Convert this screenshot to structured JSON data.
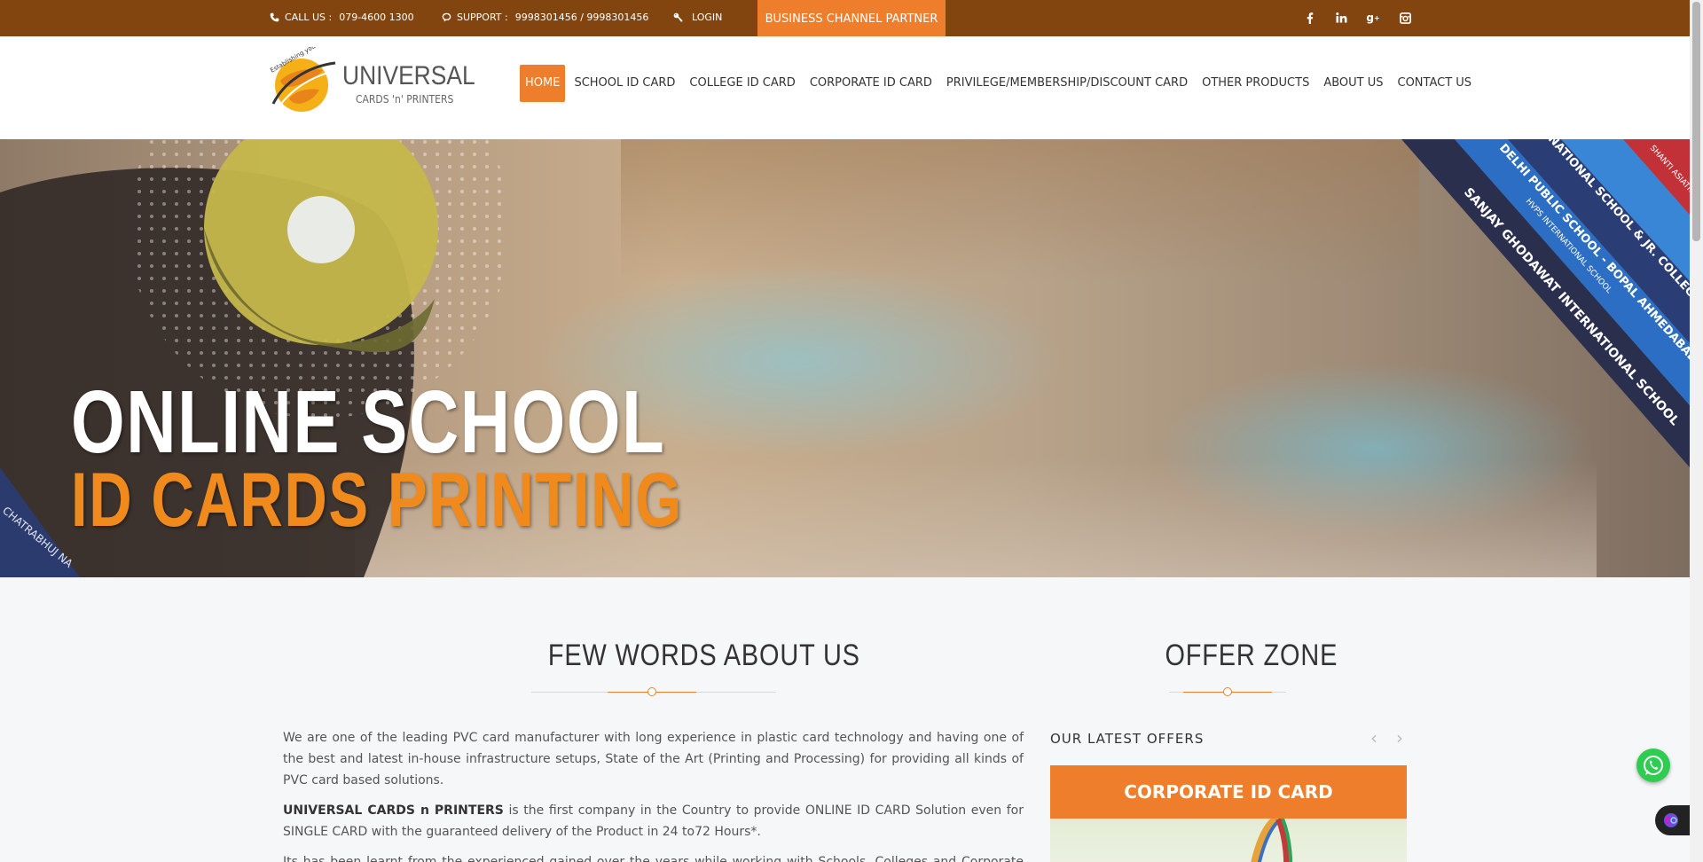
{
  "topbar": {
    "call_label": "CALL US :",
    "call_number": "079-4600 1300",
    "support_label": "SUPPORT :",
    "support_numbers": "9998301456 / 9998301456",
    "login_label": "LOGIN",
    "partner_button": "BUSINESS CHANNEL PARTNER",
    "social": [
      "facebook-icon",
      "linkedin-icon",
      "google-plus-icon",
      "instagram-icon"
    ]
  },
  "logo": {
    "tagline": "Establishing your identity",
    "name": "UNIVERSAL",
    "sub": "CARDS 'n' PRINTERS"
  },
  "nav": {
    "items": [
      "HOME",
      "SCHOOL ID CARD",
      "COLLEGE ID CARD",
      "CORPORATE ID CARD",
      "PRIVILEGE/MEMBERSHIP/DISCOUNT CARD",
      "OTHER PRODUCTS",
      "ABOUT US",
      "CONTACT US"
    ],
    "active": "HOME"
  },
  "hero": {
    "line1": "ONLINE SCHOOL",
    "line2": "ID CARDS PRINTING",
    "lanyards": [
      "NATIONAL SCHOOL & JR. COLLEGE",
      "DELHI PUBLIC SCHOOL - BOPAL AHMEDABAD",
      "SANJAY GHODAWAT INTERNATIONAL SCHOOL",
      "HVPS INTERNATIONAL SCHOOL",
      "SHANTI ASIATIC",
      "CHATRABHUJ NA"
    ]
  },
  "about": {
    "title": "FEW WORDS ABOUT US",
    "para1": "We are one of the leading PVC card manufacturer with long experience in plastic card technology and having one of the best and latest in-house infrastructure setups, State of the Art (Printing and Processing) for providing all kinds of PVC card based solutions.",
    "para2_bold": "UNIVERSAL CARDS n PRINTERS",
    "para2_rest": " is the first company in the Country to provide ONLINE ID CARD Solution even for SINGLE CARD with the guaranteed delivery of the Product in 24 to72 Hours*.",
    "para3": "Its has been learnt from the experienced gained over the years while working with Schools, Colleges and Corporate that its"
  },
  "offers": {
    "title": "OFFER ZONE",
    "latest_label": "OUR LATEST OFFERS",
    "card_title": "CORPORATE ID CARD"
  },
  "colors": {
    "topbar": "#834510",
    "accent": "#ee7e2b",
    "hero_orange": "#f08a1c"
  }
}
